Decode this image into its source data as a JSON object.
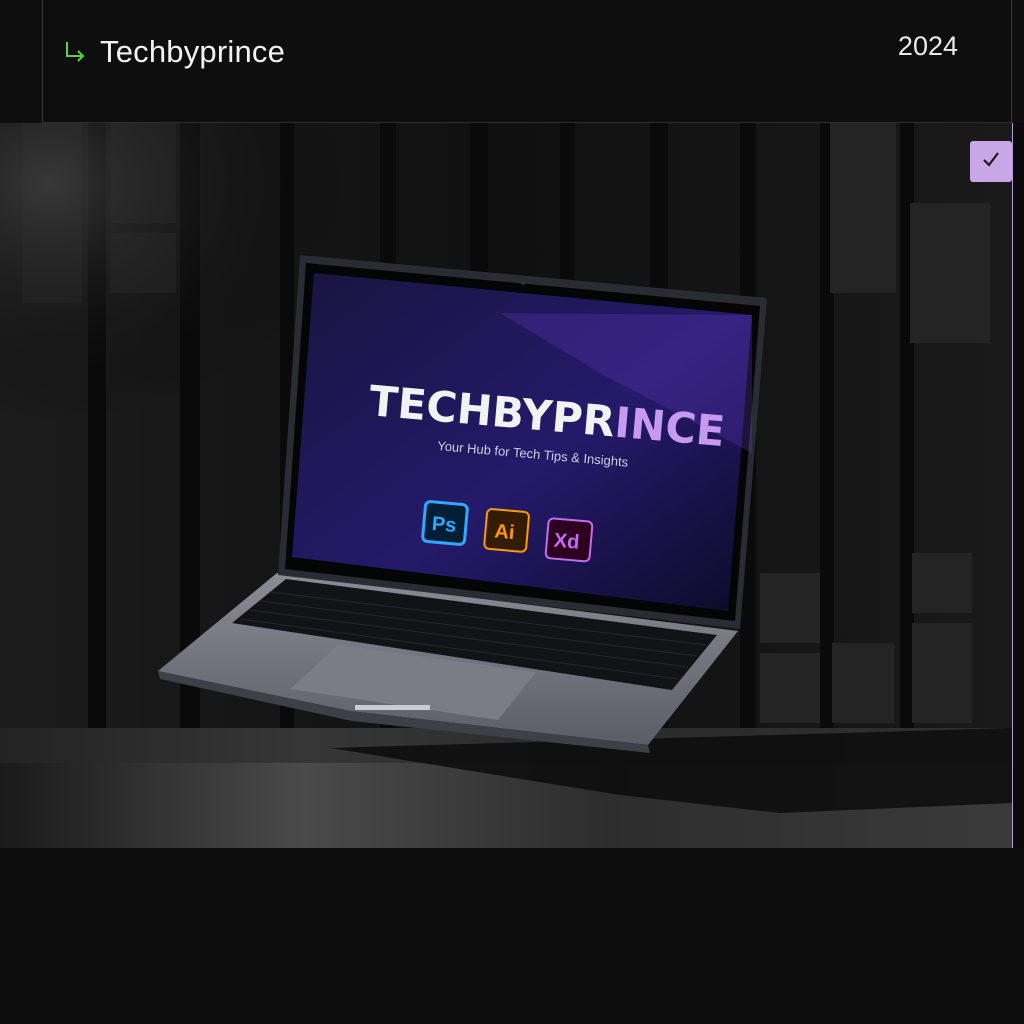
{
  "header": {
    "project_title": "Techbyprince",
    "year": "2024",
    "arrow_icon": "return-arrow-icon",
    "arrow_color": "#5fcf4a"
  },
  "badge": {
    "icon": "checkmark-icon",
    "color": "#c9a6e6"
  },
  "laptop_screen": {
    "brand_white": "TECHBYPR",
    "brand_purple": "INCE",
    "tagline": "Your Hub for Tech Tips & Insights",
    "apps": [
      {
        "name": "photoshop-app-icon",
        "label": "Ps",
        "color": "#31a8ff"
      },
      {
        "name": "illustrator-app-icon",
        "label": "Ai",
        "color": "#ff9a00"
      },
      {
        "name": "xd-app-icon",
        "label": "Xd",
        "color": "#c36cf2"
      }
    ]
  }
}
